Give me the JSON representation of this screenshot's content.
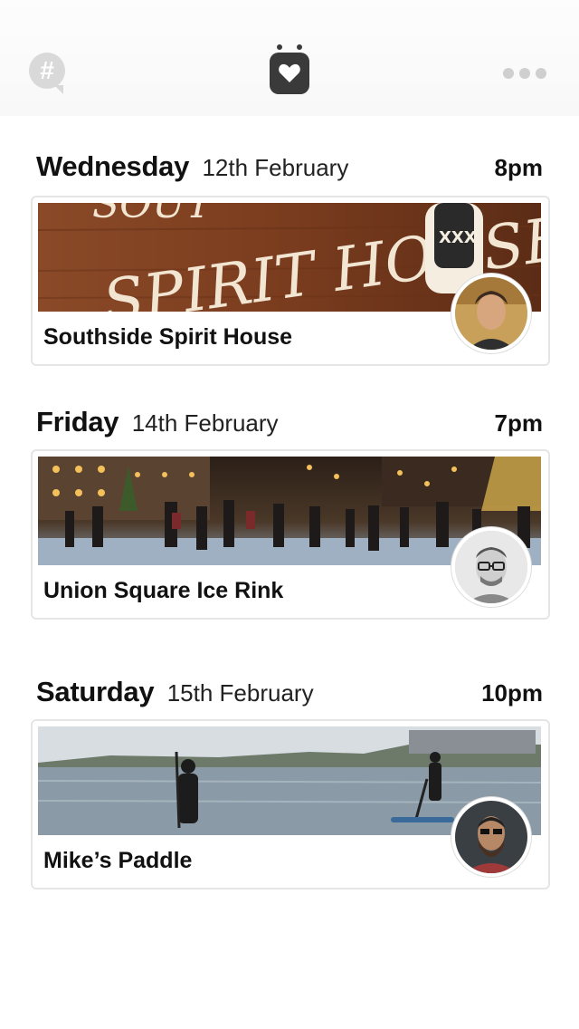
{
  "header": {
    "left_icon": "hashtag-chat-icon",
    "center_icon": "heart-logo-icon",
    "right_icon": "more-dots-icon"
  },
  "events": [
    {
      "day": "Wednesday",
      "date": "12th February",
      "time": "8pm",
      "title": "Southside Spirit House",
      "image_text": "SPIRIT HOUSE",
      "bottle_text": "XXX"
    },
    {
      "day": "Friday",
      "date": "14th February",
      "time": "7pm",
      "title": "Union Square Ice Rink"
    },
    {
      "day": "Saturday",
      "date": "15th February",
      "time": "10pm",
      "title": "Mike’s Paddle"
    }
  ],
  "colors": {
    "card_border": "#e5e5e5",
    "logo": "#3a3a3a",
    "icon_grey": "#d9d9d9"
  }
}
